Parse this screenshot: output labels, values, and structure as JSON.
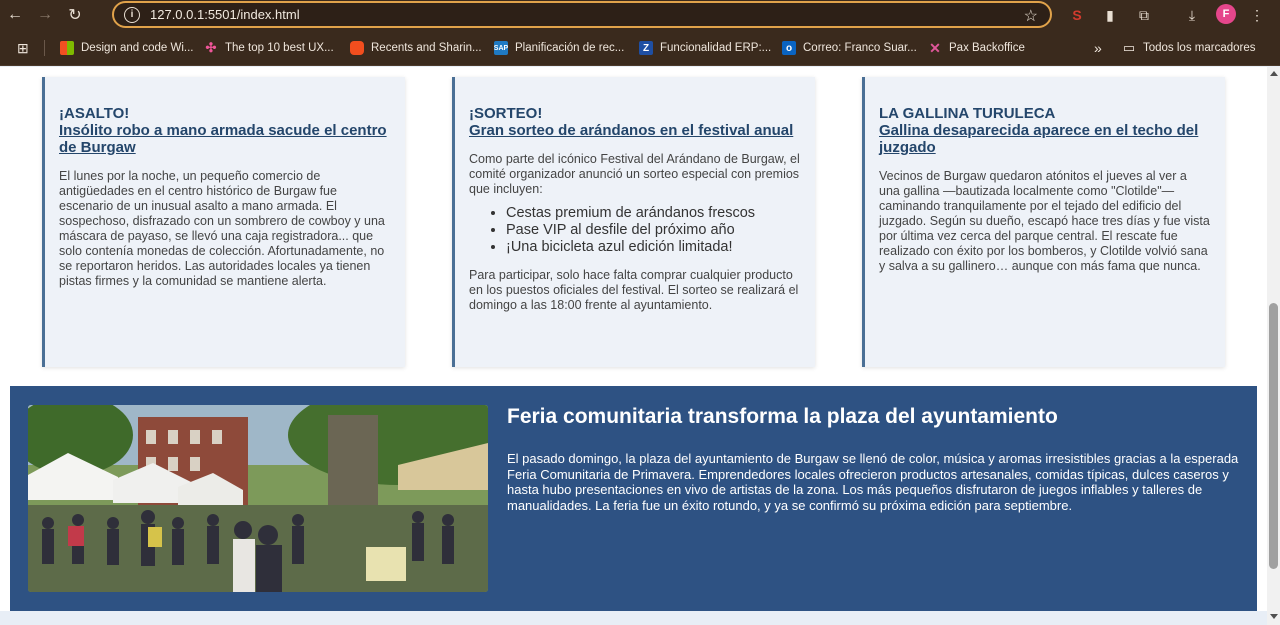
{
  "browser": {
    "url": "127.0.0.1:5501/index.html",
    "avatar_initial": "F",
    "bookmarks": [
      {
        "label": "Design and code Wi...",
        "icon": "windows-icon"
      },
      {
        "label": "The top 10 best UX...",
        "icon": "dots-icon"
      },
      {
        "label": "Recents and Sharin...",
        "icon": "figma-icon"
      },
      {
        "label": "Planificación de rec...",
        "icon": "sap-icon"
      },
      {
        "label": "Funcionalidad ERP:...",
        "icon": "z-icon"
      },
      {
        "label": "Correo: Franco Suar...",
        "icon": "outlook-icon"
      },
      {
        "label": "Pax Backoffice",
        "icon": "x-icon"
      }
    ],
    "overflow_label": "»",
    "all_bookmarks_label": "Todos los marcadores"
  },
  "cards": [
    {
      "kicker": "¡ASALTO!",
      "headline": "Insólito robo a mano armada sacude el centro de Burgaw",
      "body": "El lunes por la noche, un pequeño comercio de antigüedades en el centro histórico de Burgaw fue escenario de un inusual asalto a mano armada. El sospechoso, disfrazado con un sombrero de cowboy y una máscara de payaso, se llevó una caja registradora... que solo contenía monedas de colección. Afortunadamente, no se reportaron heridos. Las autoridades locales ya tienen pistas firmes y la comunidad se mantiene alerta."
    },
    {
      "kicker": "¡SORTEO!",
      "headline": "Gran sorteo de arándanos en el festival anual",
      "body": "Como parte del icónico Festival del Arándano de Burgaw, el comité organizador anunció un sorteo especial con premios que incluyen:",
      "list": [
        "Cestas premium de arándanos frescos",
        "Pase VIP al desfile del próximo año",
        "¡Una bicicleta azul edición limitada!"
      ],
      "body_after": "Para participar, solo hace falta comprar cualquier producto en los puestos oficiales del festival. El sorteo se realizará el domingo a las 18:00 frente al ayuntamiento."
    },
    {
      "kicker": "LA GALLINA TURULECA",
      "headline": "Gallina desaparecida aparece en el techo del juzgado",
      "body": "Vecinos de Burgaw quedaron atónitos el jueves al ver a una gallina —bautizada localmente como \"Clotilde\"— caminando tranquilamente por el tejado del edificio del juzgado. Según su dueño, escapó hace tres días y fue vista por última vez cerca del parque central. El rescate fue realizado con éxito por los bomberos, y Clotilde volvió sana y salva a su gallinero… aunque con más fama que nunca."
    }
  ],
  "feature": {
    "title": "Feria comunitaria transforma la plaza del ayuntamiento",
    "body": "El pasado domingo, la plaza del ayuntamiento de Burgaw se llenó de color, música y aromas irresistibles gracias a la esperada Feria Comunitaria de Primavera. Emprendedores locales ofrecieron productos artesanales, comidas típicas, dulces caseros y hasta hubo presentaciones en vivo de artistas de la zona. Los más pequeños disfrutaron de juegos inflables y talleres de manualidades. La feria fue un éxito rotundo, y ya se confirmó su próxima edición para septiembre."
  },
  "colors": {
    "accent": "#24466b",
    "feature_bg": "#2e5283",
    "card_bg": "#eef2f8",
    "chrome_bg": "#3a2a1d"
  }
}
